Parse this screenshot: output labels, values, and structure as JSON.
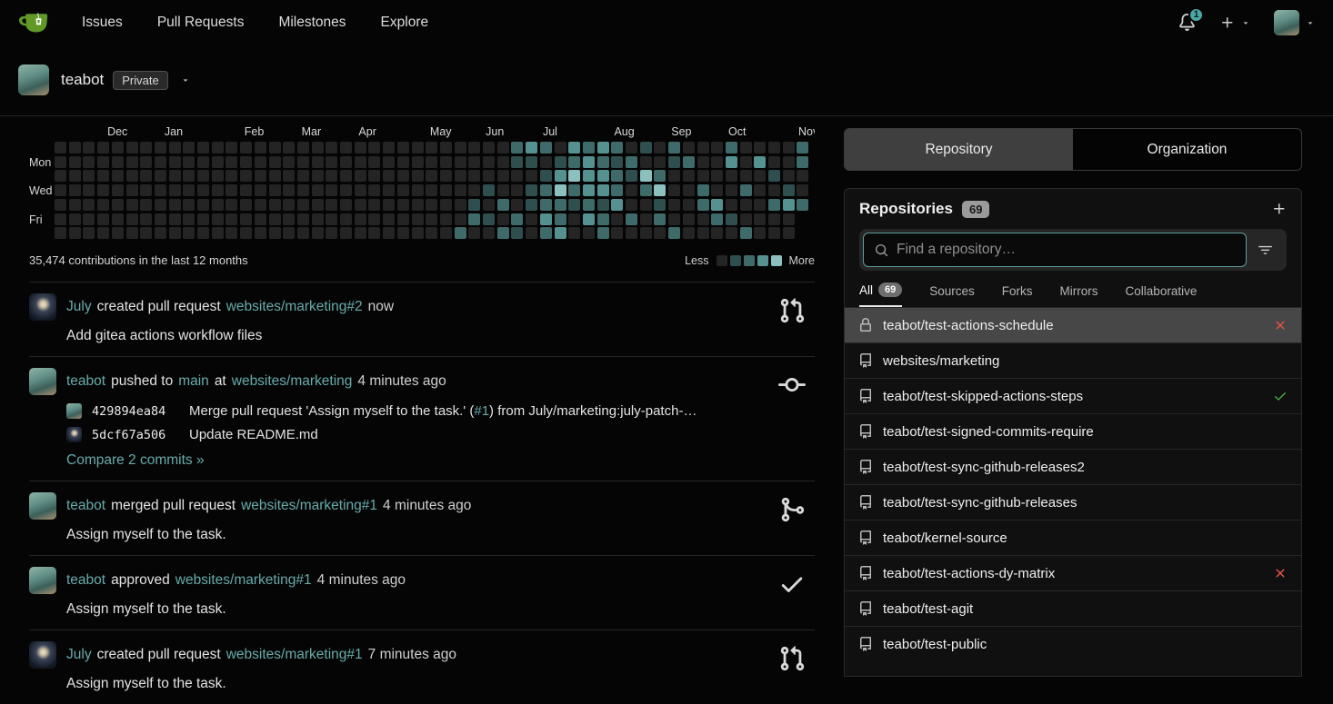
{
  "navbar": {
    "items": [
      {
        "label": "Issues"
      },
      {
        "label": "Pull Requests"
      },
      {
        "label": "Milestones"
      },
      {
        "label": "Explore"
      }
    ],
    "notification_count": "1"
  },
  "header": {
    "name": "teabot",
    "visibility_badge": "Private"
  },
  "chart_data": {
    "type": "heatmap",
    "title": "35,474 contributions in the last 12 months",
    "legend": {
      "less": "Less",
      "more": "More"
    },
    "palette": [
      "#242424",
      "#2f4f4e",
      "#3e6b6a",
      "#549190",
      "#8bc0bf"
    ],
    "months": [
      {
        "label": "Dec",
        "col": 3.7
      },
      {
        "label": "Jan",
        "col": 7.7
      },
      {
        "label": "Feb",
        "col": 13.3
      },
      {
        "label": "Mar",
        "col": 17.3
      },
      {
        "label": "Apr",
        "col": 21.3
      },
      {
        "label": "May",
        "col": 26.3
      },
      {
        "label": "Jun",
        "col": 30.2
      },
      {
        "label": "Jul",
        "col": 34.2
      },
      {
        "label": "Aug",
        "col": 39.2
      },
      {
        "label": "Sep",
        "col": 43.2
      },
      {
        "label": "Oct",
        "col": 47.2
      },
      {
        "label": "Nov",
        "col": 52.1
      }
    ],
    "day_labels": [
      {
        "label": "Mon",
        "row": 1
      },
      {
        "label": "Wed",
        "row": 3
      },
      {
        "label": "Fri",
        "row": 5
      }
    ],
    "weeks": [
      "0000000",
      "0000000",
      "0000000",
      "0000000",
      "0000000",
      "0000000",
      "0000000",
      "0000000",
      "0000000",
      "0000000",
      "0000000",
      "0000000",
      "0000000",
      "0000000",
      "0000000",
      "0000000",
      "0000000",
      "0000000",
      "0000000",
      "0000000",
      "0000000",
      "0000000",
      "0000000",
      "0000000",
      "0000000",
      "0000000",
      "0000000",
      "0000000",
      "0000002",
      "0000120",
      "0001010",
      "0000202",
      "2100021",
      "3101100",
      "2012232",
      "0134223",
      "3242100",
      "2333230",
      "3233122",
      "2122300",
      "0210020",
      "1042000",
      "0024120",
      "2100002",
      "0200000",
      "0002200",
      "0000320",
      "2300010",
      "0002002",
      "0300000",
      "0010200",
      "0001300",
      "22002"
    ]
  },
  "feed": {
    "items": [
      {
        "avatar": "july",
        "icon": "git-pull-request",
        "actor": "July",
        "action": "created pull request",
        "target": "websites/marketing#2",
        "time": "now",
        "body": "Add gitea actions workflow files"
      },
      {
        "avatar": "teabot",
        "icon": "git-commit",
        "actor": "teabot",
        "action": "pushed to",
        "branch": "main",
        "connector": "at",
        "repo": "websites/marketing",
        "time": "4 minutes ago",
        "commits": [
          {
            "avatar": "teabot",
            "sha": "429894ea84",
            "msg_pre": "Merge pull request 'Assign myself to the task.' (",
            "msg_link": "#1",
            "msg_post": ") from July/marketing:july-patch-…"
          },
          {
            "avatar": "july",
            "sha": "5dcf67a506",
            "msg_pre": "Update README.md",
            "msg_link": "",
            "msg_post": ""
          }
        ],
        "compare": "Compare 2 commits »"
      },
      {
        "avatar": "teabot",
        "icon": "git-merge",
        "actor": "teabot",
        "action": "merged pull request",
        "target": "websites/marketing#1",
        "time": "4 minutes ago",
        "body": "Assign myself to the task."
      },
      {
        "avatar": "teabot",
        "icon": "check",
        "actor": "teabot",
        "action": "approved",
        "target": "websites/marketing#1",
        "time": "4 minutes ago",
        "body_link": "Assign myself to the task."
      },
      {
        "avatar": "july",
        "icon": "git-pull-request",
        "actor": "July",
        "action": "created pull request",
        "target": "websites/marketing#1",
        "time": "7 minutes ago",
        "body": "Assign myself to the task."
      }
    ]
  },
  "sidebar": {
    "switch": {
      "repository": "Repository",
      "organization": "Organization",
      "active": "repository"
    },
    "panel_title": "Repositories",
    "panel_count": "69",
    "search": {
      "placeholder": "Find a repository…"
    },
    "filter_tabs": [
      {
        "label": "All",
        "count": "69",
        "active": true
      },
      {
        "label": "Sources"
      },
      {
        "label": "Forks"
      },
      {
        "label": "Mirrors"
      },
      {
        "label": "Collaborative"
      }
    ],
    "repos": [
      {
        "name": "teabot/test-actions-schedule",
        "icon": "lock",
        "status": "x",
        "active": true
      },
      {
        "name": "websites/marketing",
        "icon": "repo",
        "status": ""
      },
      {
        "name": "teabot/test-skipped-actions-steps",
        "icon": "repo",
        "status": "check"
      },
      {
        "name": "teabot/test-signed-commits-require",
        "icon": "repo",
        "status": ""
      },
      {
        "name": "teabot/test-sync-github-releases2",
        "icon": "repo",
        "status": ""
      },
      {
        "name": "teabot/test-sync-github-releases",
        "icon": "repo",
        "status": ""
      },
      {
        "name": "teabot/kernel-source",
        "icon": "repo",
        "status": ""
      },
      {
        "name": "teabot/test-actions-dy-matrix",
        "icon": "repo",
        "status": "x"
      },
      {
        "name": "teabot/test-agit",
        "icon": "repo",
        "status": ""
      },
      {
        "name": "teabot/test-public",
        "icon": "repo",
        "status": ""
      }
    ]
  },
  "icons": {
    "logo": "gitea-teacup",
    "bell": "notification-bell",
    "plus": "create-new",
    "search": "magnifier",
    "filter": "filter-lines",
    "x": "red-cross",
    "check": "green-check"
  }
}
